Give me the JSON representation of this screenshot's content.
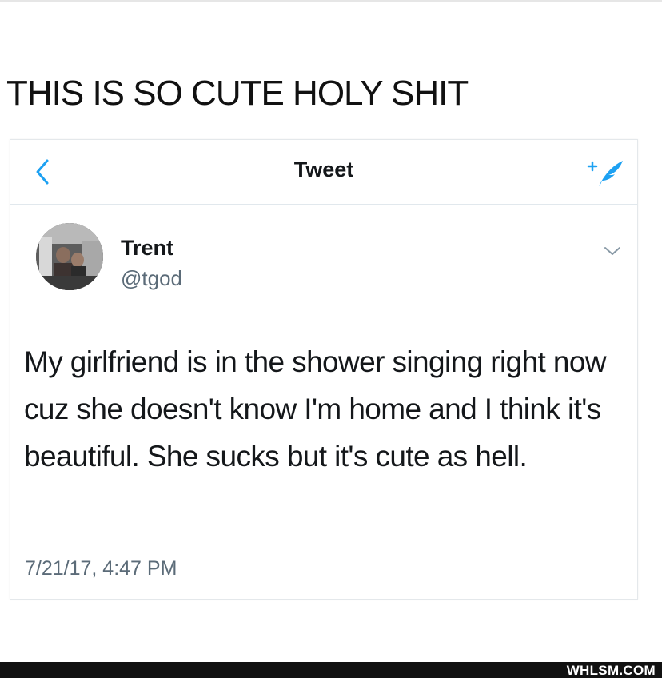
{
  "caption": "THIS IS SO CUTE HOLY SHIT",
  "nav": {
    "title": "Tweet",
    "back_icon": "chevron-left-icon",
    "compose_icon": "compose-tweet-icon"
  },
  "tweet": {
    "author_name": "Trent",
    "author_handle": "@tgod",
    "text": "My girlfriend is in the shower singing right now cuz she doesn't know I'm home and I think it's beautiful. She sucks but it's cute as hell.",
    "timestamp": "7/21/17, 4:47 PM",
    "menu_icon": "chevron-down-icon"
  },
  "watermark": "WHLSM.COM",
  "colors": {
    "accent": "#1da1f2",
    "text": "#14171a",
    "secondary_text": "#5b6b78",
    "divider": "#e1e8ed",
    "footer": "#111111"
  }
}
